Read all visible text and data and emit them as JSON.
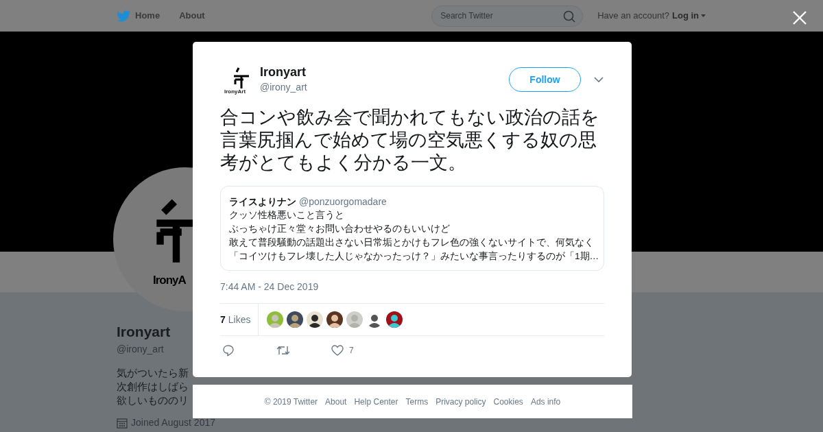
{
  "navbar": {
    "links": [
      {
        "label": "Home"
      },
      {
        "label": "About"
      }
    ],
    "search": {
      "placeholder": "Search Twitter"
    },
    "account_prompt": "Have an account?",
    "login": "Log in"
  },
  "profile": {
    "avatar_logo_text": "IronyA",
    "name": "Ironyart",
    "handle": "@irony_art",
    "bio_lines": [
      "気がついたら新",
      "次創作はしばら",
      "欲しいもののリ"
    ],
    "joined": "Joined August 2017"
  },
  "tweet": {
    "author": {
      "name": "Ironyart",
      "handle": "@irony_art",
      "logo_text": "IronyArt"
    },
    "follow": "Follow",
    "text": "合コンや飲み会で聞かれてもない政治の話を言葉尻掴んで始めて場の空気悪くする奴の思考がとてもよく分かる一文。",
    "quote": {
      "name": "ライスよりナン",
      "handle": "@ponzuorgomadare",
      "lines": [
        "クッソ性格悪いこと言うと",
        "ぶっちゃけ正々堂々お問い合わせやるのもいいけど",
        "敢えて普段騒動の話題出さない日常垢とかけもフレ色の強くないサイトで、何気なく",
        "「コイツけもフレ壊した人じゃなかったっけ？」みたいな事言ったりするのが「1期…"
      ]
    },
    "timestamp": "7:44 AM - 24 Dec 2019",
    "likes_count": "7",
    "likes_label": "Likes",
    "likers": [
      {
        "kind": "avatar"
      },
      {
        "kind": "avatar"
      },
      {
        "kind": "avatar"
      },
      {
        "kind": "avatar"
      },
      {
        "kind": "avatar"
      },
      {
        "kind": "avatar"
      },
      {
        "kind": "avatar"
      }
    ],
    "heart_count": "7"
  },
  "footer": [
    "© 2019 Twitter",
    "About",
    "Help Center",
    "Terms",
    "Privacy policy",
    "Cookies",
    "Ads info"
  ]
}
